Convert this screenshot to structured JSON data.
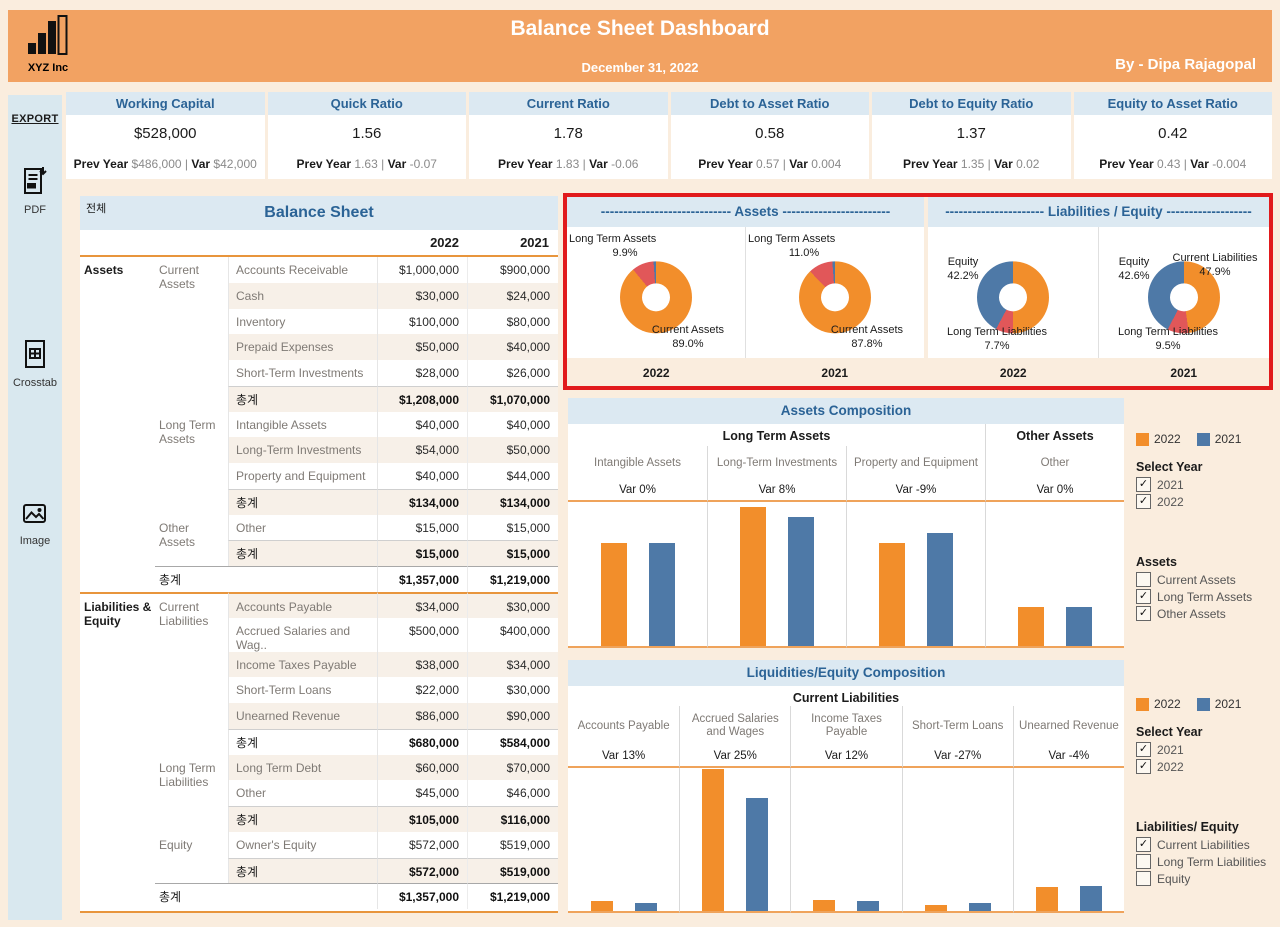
{
  "header": {
    "company": "XYZ Inc",
    "title": "Balance Sheet Dashboard",
    "date": "December 31, 2022",
    "author": "By - Dipa Rajagopal"
  },
  "export_sidebar": {
    "title": "EXPORT",
    "items": [
      {
        "label": "PDF",
        "icon": "pdf-icon"
      },
      {
        "label": "Crosstab",
        "icon": "crosstab-icon"
      },
      {
        "label": "Image",
        "icon": "image-icon"
      }
    ]
  },
  "kpi_labels": {
    "prev": "Prev Year",
    "sep": "|",
    "var": "Var"
  },
  "kpis": [
    {
      "title": "Working Capital",
      "value": "$528,000",
      "prev_value": "$486,000",
      "var_value": "$42,000"
    },
    {
      "title": "Quick Ratio",
      "value": "1.56",
      "prev_value": "1.63",
      "var_value": "-0.07"
    },
    {
      "title": "Current Ratio",
      "value": "1.78",
      "prev_value": "1.83",
      "var_value": "-0.06"
    },
    {
      "title": "Debt to Asset Ratio",
      "value": "0.58",
      "prev_value": "0.57",
      "var_value": "0.004"
    },
    {
      "title": "Debt to Equity Ratio",
      "value": "1.37",
      "prev_value": "1.35",
      "var_value": "0.02"
    },
    {
      "title": "Equity to Asset Ratio",
      "value": "0.42",
      "prev_value": "0.43",
      "var_value": "-0.004"
    }
  ],
  "balance_sheet": {
    "filter_label": "전체",
    "title": "Balance Sheet",
    "columns": [
      "2022",
      "2021"
    ],
    "total_label": "총계",
    "rows": [
      {
        "cat": "Assets",
        "cat_span": 13,
        "sub": "Current Assets",
        "sub_span": 6,
        "item": "Accounts Receivable",
        "v2022": "$1,000,000",
        "v2021": "$900,000"
      },
      {
        "item": "Cash",
        "v2022": "$30,000",
        "v2021": "$24,000"
      },
      {
        "item": "Inventory",
        "v2022": "$100,000",
        "v2021": "$80,000"
      },
      {
        "item": "Prepaid Expenses",
        "v2022": "$50,000",
        "v2021": "$40,000"
      },
      {
        "item": "Short-Term Investments",
        "v2022": "$28,000",
        "v2021": "$26,000"
      },
      {
        "type": "subtotal",
        "v2022": "$1,208,000",
        "v2021": "$1,070,000"
      },
      {
        "sub": "Long Term Assets",
        "sub_span": 4,
        "item": "Intangible Assets",
        "v2022": "$40,000",
        "v2021": "$40,000"
      },
      {
        "item": "Long-Term Investments",
        "v2022": "$54,000",
        "v2021": "$50,000"
      },
      {
        "item": "Property and Equipment",
        "v2022": "$40,000",
        "v2021": "$44,000"
      },
      {
        "type": "subtotal",
        "v2022": "$134,000",
        "v2021": "$134,000"
      },
      {
        "sub": "Other Assets",
        "sub_span": 2,
        "item": "Other",
        "v2022": "$15,000",
        "v2021": "$15,000"
      },
      {
        "type": "subtotal",
        "v2022": "$15,000",
        "v2021": "$15,000"
      },
      {
        "type": "grand",
        "v2022": "$1,357,000",
        "v2021": "$1,219,000"
      },
      {
        "cat": "Liabilities & Equity",
        "cat_span": 12,
        "sub": "Current Liabilities",
        "sub_span": 6,
        "item": "Accounts Payable",
        "v2022": "$34,000",
        "v2021": "$30,000",
        "section_break": true
      },
      {
        "item": "Accrued Salaries and Wag..",
        "v2022": "$500,000",
        "v2021": "$400,000"
      },
      {
        "item": "Income Taxes Payable",
        "v2022": "$38,000",
        "v2021": "$34,000"
      },
      {
        "item": "Short-Term Loans",
        "v2022": "$22,000",
        "v2021": "$30,000"
      },
      {
        "item": "Unearned Revenue",
        "v2022": "$86,000",
        "v2021": "$90,000"
      },
      {
        "type": "subtotal",
        "v2022": "$680,000",
        "v2021": "$584,000"
      },
      {
        "sub": "Long Term Liabilities",
        "sub_span": 3,
        "item": "Long Term Debt",
        "v2022": "$60,000",
        "v2021": "$70,000"
      },
      {
        "item": "Other",
        "v2022": "$45,000",
        "v2021": "$46,000"
      },
      {
        "type": "subtotal",
        "v2022": "$105,000",
        "v2021": "$116,000"
      },
      {
        "sub": "Equity",
        "sub_span": 2,
        "item": "Owner's Equity",
        "v2022": "$572,000",
        "v2021": "$519,000"
      },
      {
        "type": "subtotal",
        "v2022": "$572,000",
        "v2021": "$519,000"
      },
      {
        "type": "grand",
        "v2022": "$1,357,000",
        "v2021": "$1,219,000"
      }
    ]
  },
  "donuts": {
    "colors": {
      "current": "#F28E2B",
      "long_term": "#E15759",
      "other": "#4E79A7"
    },
    "assets": {
      "dashes_left": "----------------------------- ",
      "title": "Assets",
      "dashes_right": " ------------------------",
      "labels": {
        "long_term": "Long Term Assets",
        "current": "Current Assets"
      },
      "years": [
        {
          "year": "2022",
          "long_term_pct": "9.9%",
          "current_pct": "89.0%",
          "segments": [
            [
              "#F28E2B",
              89.0
            ],
            [
              "#E15759",
              9.9
            ],
            [
              "#4E79A7",
              1.1
            ]
          ]
        },
        {
          "year": "2021",
          "long_term_pct": "11.0%",
          "current_pct": "87.8%",
          "segments": [
            [
              "#F28E2B",
              87.8
            ],
            [
              "#E15759",
              11.0
            ],
            [
              "#4E79A7",
              1.2
            ]
          ]
        }
      ]
    },
    "liabilities": {
      "dashes_left": "---------------------- ",
      "title": "Liabilities / Equity",
      "dashes_right": " -------------------",
      "labels": {
        "equity": "Equity",
        "long_term": "Long Term Liabilities",
        "current": "Current Liabilities"
      },
      "years": [
        {
          "year": "2022",
          "equity_pct": "42.2%",
          "long_term_pct": "7.7%",
          "segments": [
            [
              "#F28E2B",
              50.1
            ],
            [
              "#E15759",
              7.7
            ],
            [
              "#4E79A7",
              42.2
            ]
          ]
        },
        {
          "year": "2021",
          "equity_pct": "42.6%",
          "long_term_pct": "9.5%",
          "current_pct": "47.9%",
          "segments": [
            [
              "#F28E2B",
              47.9
            ],
            [
              "#E15759",
              9.5
            ],
            [
              "#4E79A7",
              42.6
            ]
          ]
        }
      ]
    }
  },
  "assets_composition": {
    "title": "Assets Composition",
    "type": "bar",
    "ymax": 56000,
    "series_years": [
      "2022",
      "2021"
    ],
    "groups": [
      {
        "label": "Long Term Assets",
        "cols": [
          {
            "label": "Intangible Assets",
            "var": "Var 0%",
            "y2022": 40000,
            "y2021": 40000
          },
          {
            "label": "Long-Term Investments",
            "var": "Var 8%",
            "y2022": 54000,
            "y2021": 50000
          },
          {
            "label": "Property and Equipment",
            "var": "Var -9%",
            "y2022": 40000,
            "y2021": 44000
          }
        ]
      },
      {
        "label": "Other Assets",
        "cols": [
          {
            "label": "Other",
            "var": "Var 0%",
            "y2022": 15000,
            "y2021": 15000
          }
        ]
      }
    ]
  },
  "liquidities_composition": {
    "title": "Liquidities/Equity Composition",
    "type": "bar",
    "ymax": 505000,
    "series_years": [
      "2022",
      "2021"
    ],
    "groups": [
      {
        "label": "Current Liabilities",
        "cols": [
          {
            "label": "Accounts Payable",
            "var": "Var 13%",
            "y2022": 34000,
            "y2021": 30000
          },
          {
            "label": "Accrued Salaries and Wages",
            "var": "Var 25%",
            "y2022": 500000,
            "y2021": 400000
          },
          {
            "label": "Income Taxes Payable",
            "var": "Var 12%",
            "y2022": 38000,
            "y2021": 34000
          },
          {
            "label": "Short-Term Loans",
            "var": "Var -27%",
            "y2022": 22000,
            "y2021": 30000
          },
          {
            "label": "Unearned Revenue",
            "var": "Var -4%",
            "y2022": 86000,
            "y2021": 90000
          }
        ]
      }
    ]
  },
  "assets_controls": {
    "legend": [
      {
        "label": "2022",
        "color": "#F28E2B"
      },
      {
        "label": "2021",
        "color": "#4E79A7"
      }
    ],
    "select_year": {
      "title": "Select Year",
      "options": [
        {
          "label": "2021",
          "checked": true
        },
        {
          "label": "2022",
          "checked": true
        }
      ]
    },
    "category": {
      "title": "Assets",
      "options": [
        {
          "label": "Current Assets",
          "checked": false
        },
        {
          "label": "Long Term Assets",
          "checked": true
        },
        {
          "label": "Other Assets",
          "checked": true
        }
      ]
    }
  },
  "liabilities_controls": {
    "legend": [
      {
        "label": "2022",
        "color": "#F28E2B"
      },
      {
        "label": "2021",
        "color": "#4E79A7"
      }
    ],
    "select_year": {
      "title": "Select Year",
      "options": [
        {
          "label": "2021",
          "checked": true
        },
        {
          "label": "2022",
          "checked": true
        }
      ]
    },
    "category": {
      "title": "Liabilities/ Equity",
      "options": [
        {
          "label": "Current Liabilities",
          "checked": true
        },
        {
          "label": "Long Term Liabilities",
          "checked": false
        },
        {
          "label": "Equity",
          "checked": false
        }
      ]
    }
  }
}
